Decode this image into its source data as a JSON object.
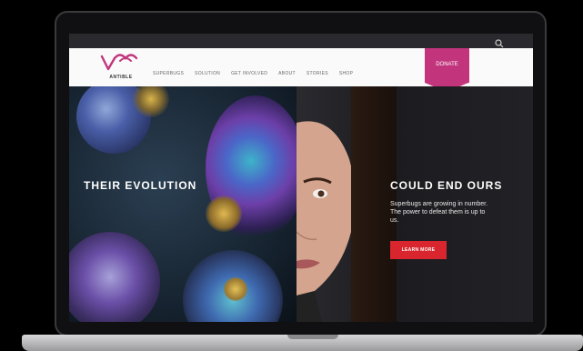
{
  "site": {
    "logo_text": "ANTIBLE"
  },
  "nav": {
    "items": [
      "SUPERBUGS",
      "SOLUTION",
      "GET INVOLVED",
      "ABOUT",
      "STORIES",
      "SHOP"
    ],
    "donate_label": "DONATE"
  },
  "hero": {
    "headline_left": "THEIR EVOLUTION",
    "headline_right": "COULD END OURS",
    "body": "Superbugs are growing in number. The power to defeat them is up to us.",
    "cta_label": "LEARN MORE"
  },
  "colors": {
    "accent": "#c2357d",
    "cta": "#d9262e"
  },
  "icons": {
    "search": "search-icon"
  }
}
